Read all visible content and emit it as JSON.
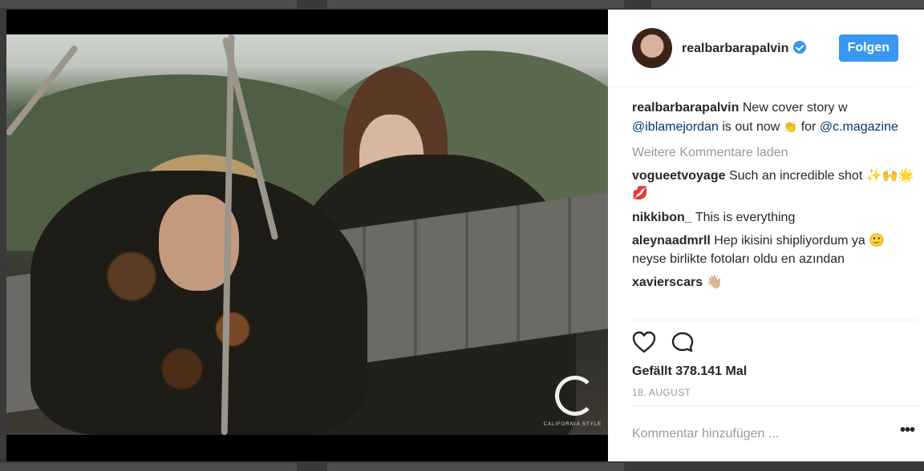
{
  "post": {
    "username": "realbarbarapalvin",
    "follow_label": "Folgen",
    "caption": {
      "user": "realbarbarapalvin",
      "text_1": "New cover story w",
      "mention_1": "@iblamejordan",
      "text_2": "is out now",
      "emoji": "👏",
      "text_3": "for",
      "mention_2": "@c.magazine"
    },
    "load_more": "Weitere Kommentare laden",
    "comments": [
      {
        "user": "vogueetvoyage",
        "text": "Such an incredible shot ✨🙌🌟💋"
      },
      {
        "user": "nikkibon_",
        "text": "This is everything"
      },
      {
        "user": "aleynaadmrll",
        "text": "Hep ikisini shipliyordum ya 🙂 neyse birlikte fotoları oldu en azından"
      },
      {
        "user": "xavierscars",
        "text": "👋🏼"
      }
    ],
    "likes": "Gefällt 378.141 Mal",
    "date": "18. AUGUST",
    "comment_placeholder": "Kommentar hinzufügen ...",
    "more_label": "•••",
    "photo_logo_text": "CALIFORNIA STYLE"
  },
  "icons": {
    "like": "heart-icon",
    "comment": "speech-bubble-icon",
    "verified": "verified-badge-icon"
  },
  "colors": {
    "accent": "#3897f0",
    "mention": "#003569",
    "muted": "#999999"
  }
}
